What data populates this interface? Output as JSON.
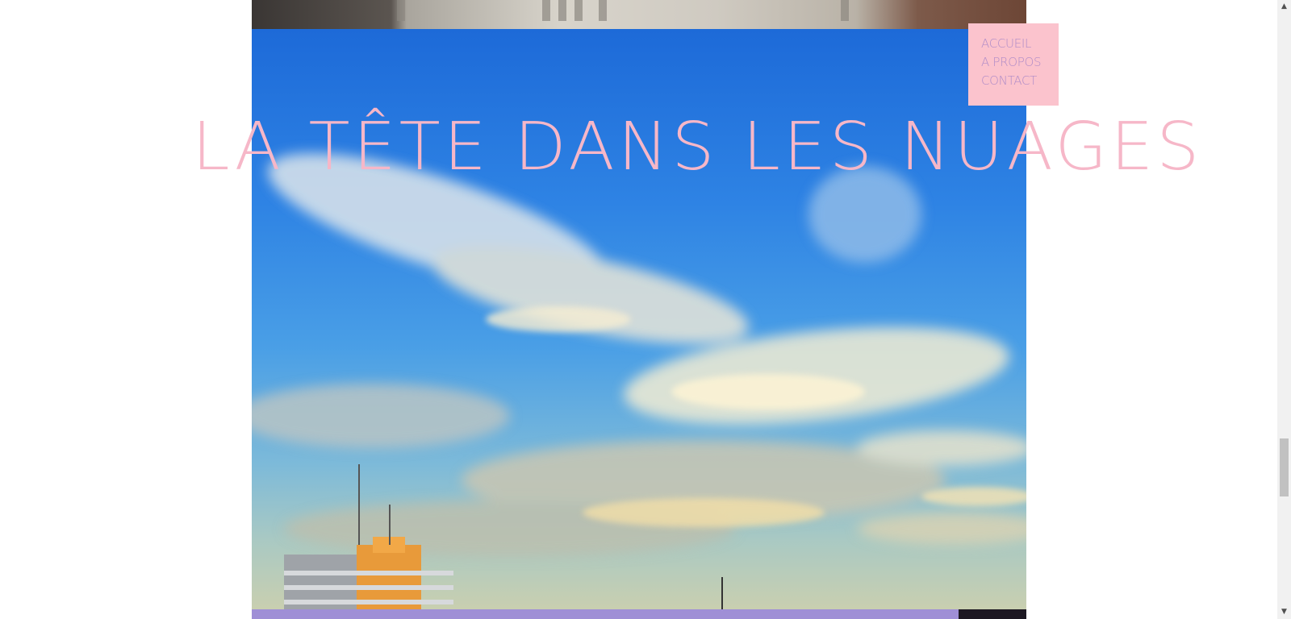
{
  "site": {
    "title": "LA TÊTE DANS LES NUAGES"
  },
  "menu": {
    "items": [
      {
        "label": "ACCUEIL"
      },
      {
        "label": "A PROPOS"
      },
      {
        "label": "CONTACT"
      }
    ]
  },
  "colors": {
    "title_pink": "#f6b7c8",
    "menu_background": "#fbc3cd",
    "menu_text": "#b08cc8",
    "band_purple": "#9f8fd6"
  },
  "icons": {
    "scroll_up": "scroll-up-arrow-icon",
    "scroll_down": "scroll-down-arrow-icon"
  }
}
